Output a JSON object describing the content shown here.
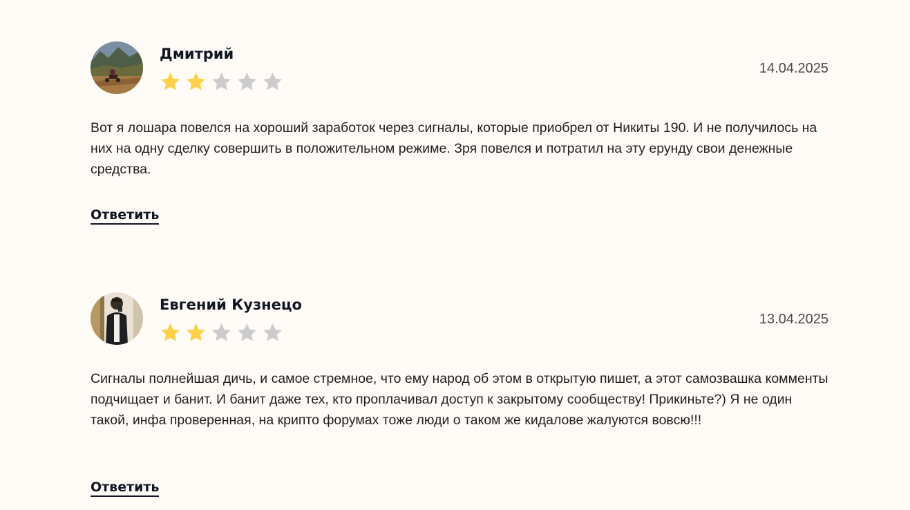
{
  "colors": {
    "background": "#fffbf7",
    "star_filled": "#fdd14a",
    "star_empty": "#cccccc",
    "author": "#111624"
  },
  "reviews": [
    {
      "author": "Дмитрий",
      "date": "14.04.2025",
      "rating": 2,
      "max_rating": 5,
      "text": "Вот я лошара повелся на хороший заработок через сигналы, которые приобрел от Никиты 190. И не получилось на них на одну сделку совершить в положительном режиме. Зря повелся и потратил на эту ерунду свои денежные средства.",
      "reply_label": "Ответить"
    },
    {
      "author": "Евгений Кузнецо",
      "date": "13.04.2025",
      "rating": 2,
      "max_rating": 5,
      "text": "Сигналы полнейшая дичь, и самое стремное, что ему народ об этом в открытую пишет, а этот самозвашка комменты подчищает и банит. И банит даже тех, кто проплачивал доступ к закрытому сообществу! Прикиньте?) Я не один такой, инфа проверенная, на крипто форумах тоже люди о таком же кидалове жалуются вовсю!!!",
      "reply_label": "Ответить"
    }
  ]
}
